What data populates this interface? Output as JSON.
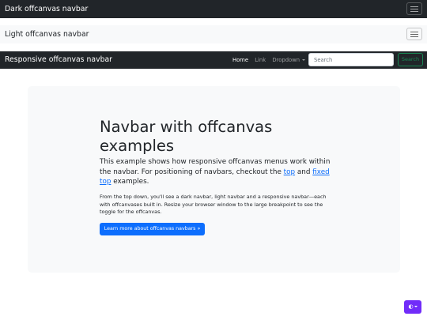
{
  "navbars": {
    "dark": {
      "brand": "Dark offcanvas navbar"
    },
    "light": {
      "brand": "Light offcanvas navbar"
    },
    "responsive": {
      "brand": "Responsive offcanvas navbar",
      "links": [
        "Home",
        "Link",
        "Dropdown"
      ],
      "active_link": "Home",
      "search_placeholder": "Search",
      "search_button": "Search"
    }
  },
  "hero": {
    "title": "Navbar with offcanvas examples",
    "lead_before": "This example shows how responsive offcanvas menus work within the navbar. For positioning of navbars, checkout the ",
    "lead_link1": "top",
    "lead_mid": " and ",
    "lead_link2": "fixed top",
    "lead_after": " examples.",
    "body": "From the top down, you'll see a dark navbar, light navbar and a responsive navbar—each with offcanvases built in. Resize your browser window to the large breakpoint to see the toggle for the offcanvas.",
    "button": "Learn more about offcanvas navbars »"
  },
  "theme_toggle": {
    "icon": "circle-half-icon"
  },
  "colors": {
    "navbar_dark": "#212529",
    "navbar_light": "#f8f9fa",
    "primary": "#0d6efd",
    "success": "#198754",
    "theme_toggle": "#712cf9",
    "hero_bg": "#f8f9fa"
  }
}
